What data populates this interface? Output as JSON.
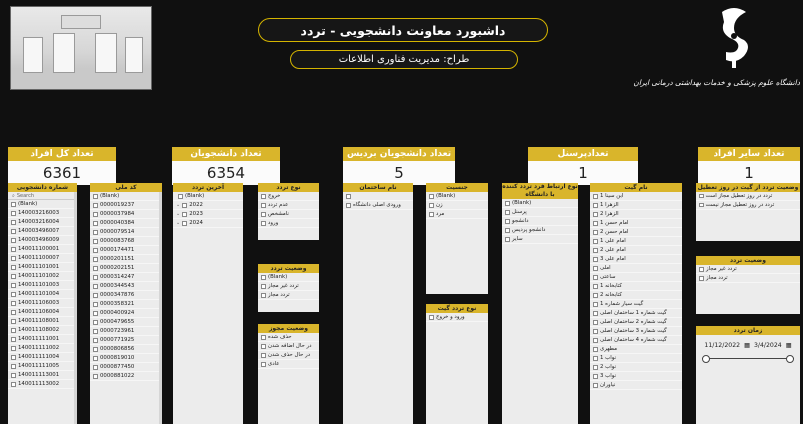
{
  "header": {
    "title": "داشبورد معاونت دانشجویی - تردد",
    "subtitle": "طراح: مدیریت فناوری اطلاعات",
    "university_name": "دانشگاه علوم پزشکی و خدمات بهداشتی درمانی ایران"
  },
  "kpis": [
    {
      "label": "تعداد کل افراد",
      "value": "6361"
    },
    {
      "label": "تعداد دانشجویان",
      "value": "6354"
    },
    {
      "label": "تعداد دانشجویان بردیس",
      "value": "5"
    },
    {
      "label": "تعدادپرسنل",
      "value": "1"
    },
    {
      "label": "تعداد سایر افراد",
      "value": "1"
    }
  ],
  "slicers": {
    "student_number": {
      "title": "شماره دانشجویی",
      "search": "Search",
      "items": [
        "(Blank)",
        "140003216003",
        "140003216004",
        "140003496007",
        "140003496009",
        "140011100001",
        "140011100007",
        "140011101001",
        "140011101002",
        "140011101003",
        "140011101004",
        "140011106003",
        "140011106004",
        "140011108001",
        "140011108002",
        "140011111001",
        "140011111002",
        "140011111004",
        "140011111005",
        "140011113001",
        "140011113002"
      ]
    },
    "national_code": {
      "title": "کد ملی",
      "items": [
        "(Blank)",
        "0000019237",
        "0000037984",
        "0000040384",
        "0000079514",
        "0000083768",
        "0000174471",
        "0000201151",
        "0000202151",
        "0000314247",
        "0000344543",
        "0000347876",
        "0000358321",
        "0000400924",
        "0000479655",
        "0000723961",
        "0000771925",
        "0000806856",
        "0000819010",
        "0000877450",
        "0000881022"
      ]
    },
    "last_traffic": {
      "title": "آخرین تردد",
      "items": [
        "(Blank)",
        "2022",
        "2023",
        "2024"
      ]
    },
    "traffic_type": {
      "title": "نوع تردد",
      "items": [
        "خروج",
        "عدم تردد",
        "نامشخص",
        "ورود"
      ]
    },
    "building_name": {
      "title": "نام ساختمان",
      "items": [
        "",
        "ورودی اصلی دانشگاه"
      ]
    },
    "gender": {
      "title": "جنسیت",
      "items": [
        "(Blank)",
        "زن",
        "مرد"
      ]
    },
    "relation_type": {
      "title": "نوع ارتباط فرد تردد کننده با دانشگاه",
      "items": [
        "(Blank)",
        "پرسنل",
        "دانشجو",
        "دانشجو پردیس",
        "سایر"
      ]
    },
    "gate_name": {
      "title": "نام گیت",
      "items": [
        "ابن سینا 1",
        "الزهرا 1",
        "الزهرا 2",
        "امام حسن 1",
        "امام حسن 2",
        "امام علی 1",
        "امام علی 2",
        "امام علی 3",
        "املی",
        "ساعتی",
        "کتابخانه 1",
        "کتابخانه 2",
        "گیت سیار شماره 1",
        "گیت شماره 1 ساختمان اصلی",
        "گیت شماره 2 ساختمان اصلی",
        "گیت شماره 3 ساختمان اصلی",
        "گیت شماره 4 ساختمان اصلی",
        "مطهری",
        "نواب 1",
        "نواب 2",
        "نواب 3",
        "نیاوران"
      ]
    },
    "gate_status": {
      "title": "وضعیت تردد از گیت در روز تعطیل",
      "items": [
        "تردد در روز تعطیل مجاز است",
        "تردد در روز تعطیل مجاز نیست"
      ]
    },
    "traffic_status": {
      "title": "وضعیت تردد",
      "items": [
        "(Blank)",
        "تردد غیر مجاز",
        "تردد مجاز"
      ]
    },
    "traffic_status_2": {
      "title": "وضعیت تردد",
      "items": [
        "تردد غیر مجاز",
        "تردد مجاز"
      ]
    },
    "permit_status": {
      "title": "وضعیت مجوز",
      "items": [
        "حذف شده",
        "در حال اضافه شدن",
        "در حال حذف شدن",
        "عادی"
      ]
    },
    "gate_traffic_type": {
      "title": "نوع تردد گیت",
      "items": [
        "ورود و خروج"
      ]
    },
    "time_range": {
      "title": "زمان تردد",
      "from": "11/12/2022",
      "to": "3/4/2024",
      "from_pct": 0,
      "to_pct": 100
    }
  },
  "colors": {
    "accent": "#d9b52b",
    "background": "#101010",
    "panel": "#ececec"
  }
}
